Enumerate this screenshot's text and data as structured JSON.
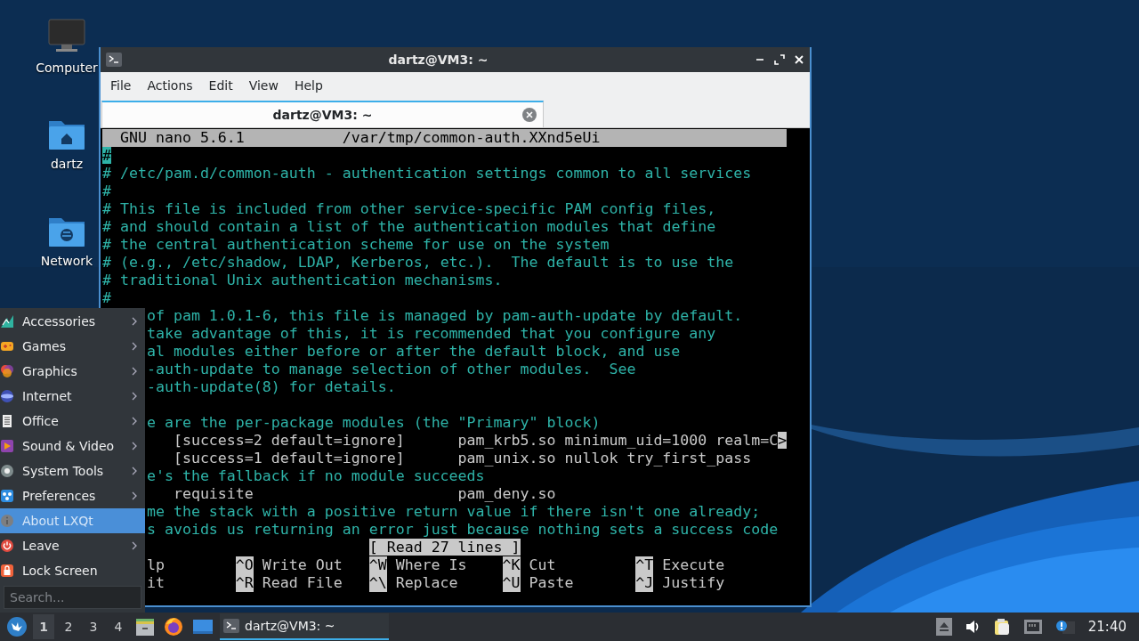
{
  "desktop_icons": [
    {
      "label": "Computer",
      "kind": "computer"
    },
    {
      "label": "dartz",
      "kind": "home"
    },
    {
      "label": "Network",
      "kind": "network"
    }
  ],
  "window": {
    "title": "dartz@VM3: ~",
    "menu": [
      "File",
      "Actions",
      "Edit",
      "View",
      "Help"
    ],
    "tabs": [
      {
        "label": "dartz@VM3: ~",
        "selected": true
      }
    ],
    "terminal": {
      "header": {
        "program": "GNU nano 5.6.1",
        "file": "/var/tmp/common-auth.XXnd5eUi"
      },
      "lines": [
        {
          "kind": "comment",
          "text": "#",
          "cursor": true
        },
        {
          "kind": "comment",
          "text": "# /etc/pam.d/common-auth - authentication settings common to all services"
        },
        {
          "kind": "comment",
          "text": "#"
        },
        {
          "kind": "comment",
          "text": "# This file is included from other service-specific PAM config files,"
        },
        {
          "kind": "comment",
          "text": "# and should contain a list of the authentication modules that define"
        },
        {
          "kind": "comment",
          "text": "# the central authentication scheme for use on the system"
        },
        {
          "kind": "comment",
          "text": "# (e.g., /etc/shadow, LDAP, Kerberos, etc.).  The default is to use the"
        },
        {
          "kind": "comment",
          "text": "# traditional Unix authentication mechanisms."
        },
        {
          "kind": "comment",
          "text": "#"
        },
        {
          "kind": "comment",
          "covered": true,
          "text": "of pam 1.0.1-6, this file is managed by pam-auth-update by default."
        },
        {
          "kind": "comment",
          "covered": true,
          "text": "take advantage of this, it is recommended that you configure any"
        },
        {
          "kind": "comment",
          "covered": true,
          "text": "al modules either before or after the default block, and use"
        },
        {
          "kind": "comment",
          "covered": true,
          "text": "-auth-update to manage selection of other modules.  See"
        },
        {
          "kind": "comment",
          "covered": true,
          "text": "-auth-update(8) for details."
        },
        {
          "kind": "blank"
        },
        {
          "kind": "comment",
          "covered": true,
          "text": "e are the per-package modules (the \"Primary\" block)"
        },
        {
          "kind": "code",
          "covered": true,
          "text": "   [success=2 default=ignore]      pam_krb5.so minimum_uid=1000 realm=C",
          "overflow_mark": ">"
        },
        {
          "kind": "code",
          "covered": true,
          "text": "   [success=1 default=ignore]      pam_unix.so nullok try_first_pass"
        },
        {
          "kind": "comment",
          "covered": true,
          "text": "e's the fallback if no module succeeds"
        },
        {
          "kind": "code",
          "covered": true,
          "text": "   requisite                       pam_deny.so"
        },
        {
          "kind": "comment",
          "covered": true,
          "text": "me the stack with a positive return value if there isn't one already;"
        },
        {
          "kind": "comment",
          "covered": true,
          "text": "s avoids us returning an error just because nothing sets a success code"
        }
      ],
      "status": "[ Read 27 lines ]",
      "shortcut_rows": [
        [
          {
            "label": "lp"
          },
          {
            "key": "^O",
            "label": "Write Out"
          },
          {
            "key": "^W",
            "label": "Where Is"
          },
          {
            "key": "^K",
            "label": "Cut"
          },
          {
            "key": "^T",
            "label": "Execute"
          }
        ],
        [
          {
            "label": "it"
          },
          {
            "key": "^R",
            "label": "Read File"
          },
          {
            "key": "^\\",
            "label": "Replace"
          },
          {
            "key": "^U",
            "label": "Paste"
          },
          {
            "key": "^J",
            "label": "Justify"
          }
        ]
      ]
    }
  },
  "app_menu": {
    "items": [
      {
        "label": "Accessories",
        "kind": "accessories",
        "submenu": true,
        "selected": false
      },
      {
        "label": "Games",
        "kind": "games",
        "submenu": true,
        "selected": false
      },
      {
        "label": "Graphics",
        "kind": "graphics",
        "submenu": true,
        "selected": false
      },
      {
        "label": "Internet",
        "kind": "internet",
        "submenu": true,
        "selected": false
      },
      {
        "label": "Office",
        "kind": "office",
        "submenu": true,
        "selected": false
      },
      {
        "label": "Sound & Video",
        "kind": "media",
        "submenu": true,
        "selected": false
      },
      {
        "label": "System Tools",
        "kind": "system",
        "submenu": true,
        "selected": false
      },
      {
        "label": "Preferences",
        "kind": "preferences",
        "submenu": true,
        "selected": false
      },
      {
        "label": "About LXQt",
        "kind": "about",
        "submenu": false,
        "selected": true
      },
      {
        "label": "Leave",
        "kind": "leave",
        "submenu": true,
        "selected": false
      },
      {
        "label": "Lock Screen",
        "kind": "lock",
        "submenu": false,
        "selected": false
      }
    ],
    "search": {
      "placeholder": "Search..."
    }
  },
  "taskbar": {
    "desktops": [
      {
        "label": "1",
        "selected": true
      },
      {
        "label": "2",
        "selected": false
      },
      {
        "label": "3",
        "selected": false
      },
      {
        "label": "4",
        "selected": false
      }
    ],
    "tasks": [
      {
        "label": "dartz@VM3: ~",
        "selected": true
      }
    ],
    "clock": "21:40"
  }
}
